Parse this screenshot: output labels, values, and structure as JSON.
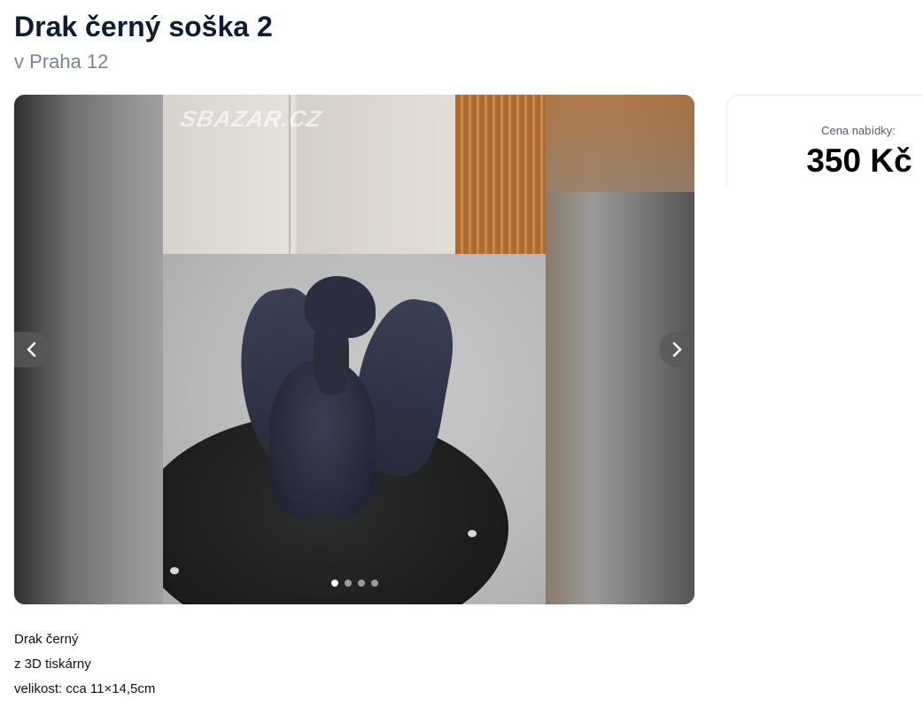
{
  "listing": {
    "title": "Drak černý soška 2",
    "location": "v Praha 12"
  },
  "gallery": {
    "watermark": "SBAZAR.CZ",
    "prev_icon": "chevron-left-icon",
    "next_icon": "chevron-right-icon",
    "image_count": 4,
    "active_index": 0
  },
  "price": {
    "label": "Cena nabídky:",
    "value": "350 Kč"
  },
  "description": {
    "lines": [
      "Drak černý",
      "z 3D tiskárny",
      "velikost: cca 11×14,5cm"
    ]
  }
}
